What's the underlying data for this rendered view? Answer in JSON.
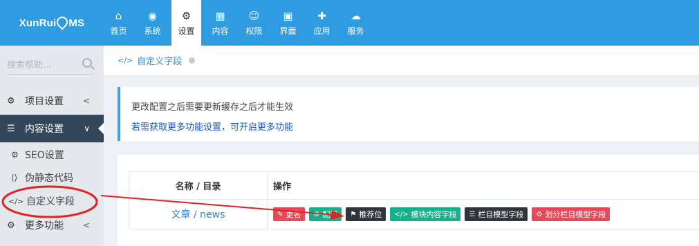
{
  "brand": {
    "name_left": "XunRui",
    "name_right": "MS"
  },
  "nav": [
    {
      "icon": "home-icon",
      "glyph": "⌂",
      "label": "首页"
    },
    {
      "icon": "globe-icon",
      "glyph": "◉",
      "label": "系统"
    },
    {
      "icon": "gears-icon",
      "glyph": "⚙",
      "label": "设置"
    },
    {
      "icon": "grid-icon",
      "glyph": "▦",
      "label": "内容"
    },
    {
      "icon": "user-icon",
      "glyph": "☺",
      "label": "权限"
    },
    {
      "icon": "html5-icon",
      "glyph": "▣",
      "label": "界面"
    },
    {
      "icon": "puzzle-icon",
      "glyph": "✚",
      "label": "应用"
    },
    {
      "icon": "cloud-icon",
      "glyph": "☁",
      "label": "服务"
    }
  ],
  "sidebar": {
    "search_placeholder": "搜索帮助...",
    "groups": [
      {
        "icon": "gear-icon",
        "glyph": "⚙",
        "label": "项目设置",
        "chevron": "<"
      },
      {
        "icon": "list-icon",
        "glyph": "☰",
        "label": "内容设置",
        "chevron": "∨"
      },
      {
        "icon": "gears-icon",
        "glyph": "⚙",
        "label": "更多功能",
        "chevron": "<"
      }
    ],
    "sub_items": [
      {
        "icon": "gear-icon",
        "glyph": "⚙",
        "label": "SEO设置"
      },
      {
        "icon": "code-box-icon",
        "glyph": "⟨⟩",
        "label": "伪静态代码"
      },
      {
        "icon": "code-icon",
        "glyph": "</>",
        "label": "自定义字段"
      }
    ]
  },
  "breadcrumb": {
    "icon": "code-icon",
    "glyph": "</>",
    "label": "自定义字段"
  },
  "notice": {
    "line1": "更改配置之后需要更新缓存之后才能生效",
    "line2": "若需获取更多功能设置，可开启更多功能"
  },
  "table": {
    "headers": [
      "名称 / 目录",
      "操作"
    ],
    "rows": [
      {
        "name": "文章 / news",
        "actions": [
          {
            "icon": "edit-icon",
            "glyph": "✎",
            "label": "更名",
            "color": "#e54a5a"
          },
          {
            "icon": "gear-icon",
            "glyph": "⚙",
            "label": "配置",
            "color": "#1aaf8b"
          },
          {
            "icon": "flag-icon",
            "glyph": "⚑",
            "label": "推荐位",
            "color": "#2f353b"
          },
          {
            "icon": "code-icon",
            "glyph": "</>",
            "label": "模块内容字段",
            "color": "#1aaf8b"
          },
          {
            "icon": "list-icon",
            "glyph": "☰",
            "label": "栏目模型字段",
            "color": "#2f353b"
          },
          {
            "icon": "gear-icon",
            "glyph": "⚙",
            "label": "划分栏目模型字段",
            "color": "#e54a5a"
          }
        ]
      }
    ]
  },
  "colors": {
    "header": "#2f9be0",
    "sidebar_active": "#34475a",
    "annotation": "#e02424"
  }
}
